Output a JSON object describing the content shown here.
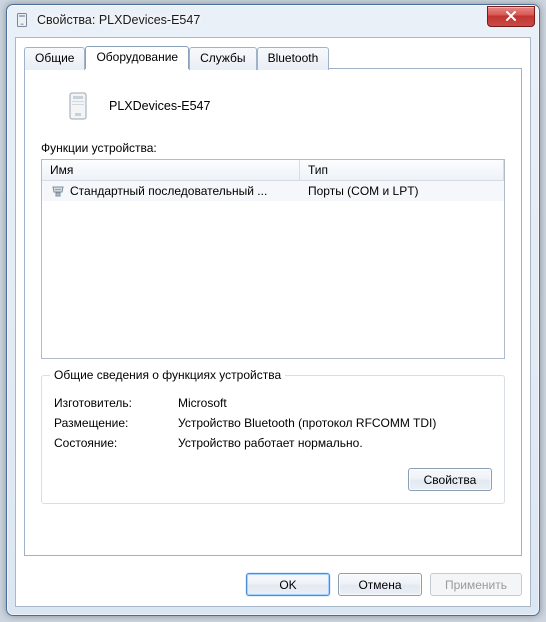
{
  "window": {
    "title": "Свойства: PLXDevices-E547"
  },
  "tabs": [
    {
      "label": "Общие"
    },
    {
      "label": "Оборудование"
    },
    {
      "label": "Службы"
    },
    {
      "label": "Bluetooth"
    }
  ],
  "device": {
    "name": "PLXDevices-E547"
  },
  "functions": {
    "label": "Функции устройства:",
    "columns": {
      "name": "Имя",
      "type": "Тип"
    },
    "rows": [
      {
        "name": "Стандартный последовательный ...",
        "type": "Порты (COM и LPT)"
      }
    ]
  },
  "details": {
    "title": "Общие сведения о функциях устройства",
    "manufacturer_label": "Изготовитель:",
    "manufacturer": "Microsoft",
    "location_label": "Размещение:",
    "location": "Устройство Bluetooth (протокол RFCOMM TDI)",
    "status_label": "Состояние:",
    "status": "Устройство работает нормально."
  },
  "buttons": {
    "properties": "Свойства",
    "ok": "OK",
    "cancel": "Отмена",
    "apply": "Применить"
  }
}
